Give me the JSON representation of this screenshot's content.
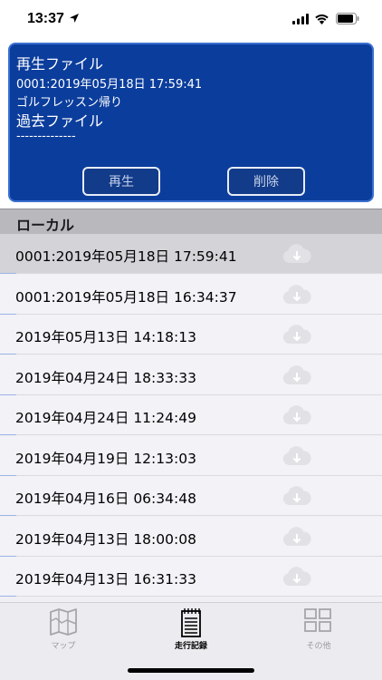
{
  "status_bar": {
    "time": "13:37"
  },
  "player": {
    "playback_file_heading": "再生ファイル",
    "playback_file_name": "0001:2019年05月18日 17:59:41",
    "playback_file_note": "ゴルフレッスン帰り",
    "past_file_heading": "過去ファイル",
    "past_file_value": "--------------",
    "play_button": "再生",
    "delete_button": "削除"
  },
  "section": {
    "title": "ローカル"
  },
  "records": [
    {
      "label": "0001:2019年05月18日 17:59:41",
      "selected": true
    },
    {
      "label": "0001:2019年05月18日 16:34:37"
    },
    {
      "label": "2019年05月13日 14:18:13"
    },
    {
      "label": "2019年04月24日 18:33:33"
    },
    {
      "label": "2019年04月24日 11:24:49"
    },
    {
      "label": "2019年04月19日 12:13:03"
    },
    {
      "label": "2019年04月16日 06:34:48"
    },
    {
      "label": "2019年04月13日 18:00:08"
    },
    {
      "label": "2019年04月13日 16:31:33"
    }
  ],
  "tabs": [
    {
      "label": "マップ",
      "icon": "map-icon"
    },
    {
      "label": "走行記録",
      "icon": "log-notebook-icon",
      "active": true
    },
    {
      "label": "その他",
      "icon": "grid-icon"
    }
  ]
}
